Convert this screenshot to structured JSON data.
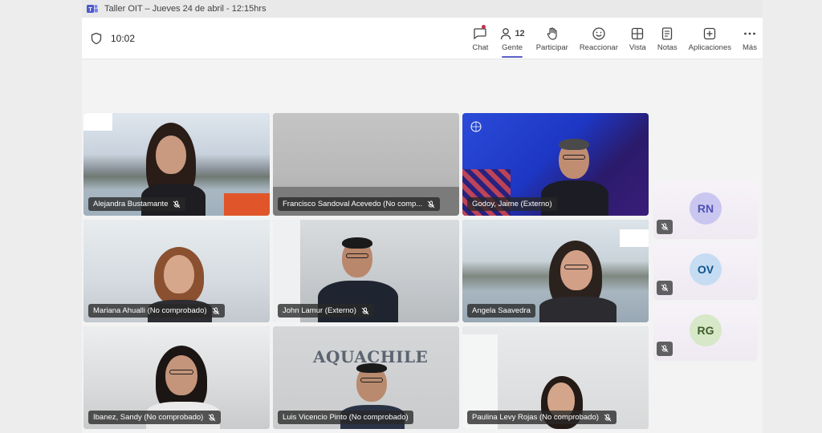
{
  "window": {
    "title": "Taller OIT – Jueves 24 de abril - 12:15hrs"
  },
  "toolbar": {
    "timer": "10:02",
    "items": [
      {
        "label": "Chat",
        "icon": "chat-icon"
      },
      {
        "label": "Gente",
        "icon": "people-icon",
        "count": "12"
      },
      {
        "label": "Participar",
        "icon": "raise-hand-icon"
      },
      {
        "label": "Reaccionar",
        "icon": "react-icon"
      },
      {
        "label": "Vista",
        "icon": "view-icon"
      },
      {
        "label": "Notas",
        "icon": "notes-icon"
      },
      {
        "label": "Aplicaciones",
        "icon": "apps-icon"
      },
      {
        "label": "Más",
        "icon": "more-icon"
      }
    ]
  },
  "tiles": [
    {
      "name": "Alejandra Bustamante"
    },
    {
      "name": "Francisco Sandoval Acevedo (No comp..."
    },
    {
      "name": "Godoy, Jaime (Externo)"
    },
    {
      "name": "Mariana Ahualli (No comprobado)"
    },
    {
      "name": "John Lamur (Externo)"
    },
    {
      "name": "Angela Saavedra"
    },
    {
      "name": "Ibanez, Sandy (No comprobado)"
    },
    {
      "name": "Luis Vicencio Pinto (No comprobado)"
    },
    {
      "name": "Paulina Levy Rojas (No comprobado)"
    }
  ],
  "sidebar_participants": [
    {
      "initials": "RN",
      "color": "#c9c7f0",
      "text_color": "#4f52b2"
    },
    {
      "initials": "OV",
      "color": "#c5dcf3",
      "text_color": "#0f548c"
    },
    {
      "initials": "RG",
      "color": "#d6e8c8",
      "text_color": "#405c2a"
    }
  ],
  "backgrounds": {
    "aquachile_text": "AQUACHILE"
  }
}
